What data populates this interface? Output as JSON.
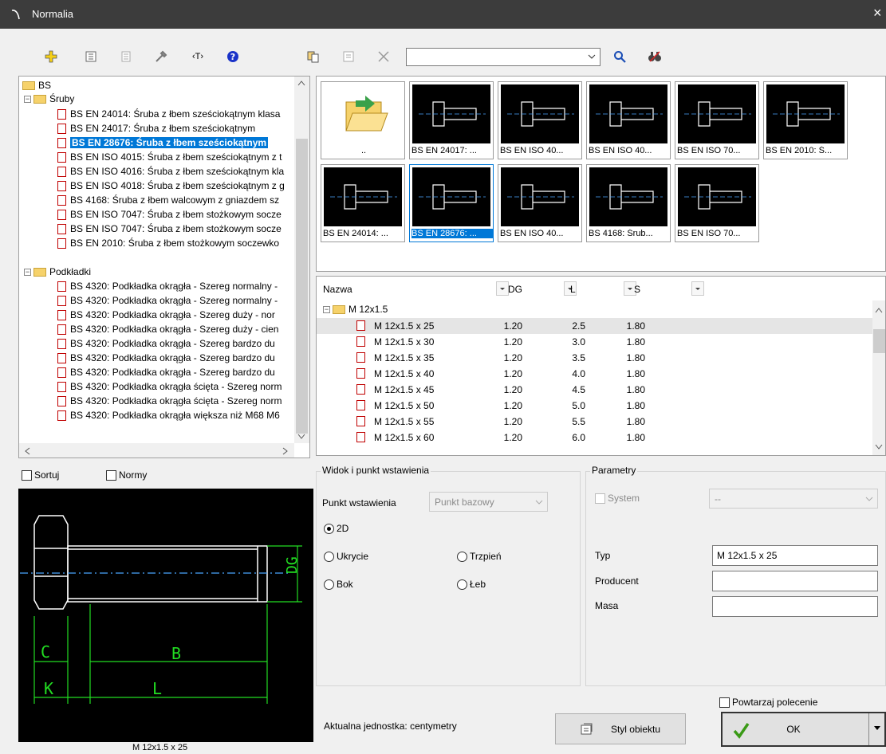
{
  "window": {
    "title": "Normalia",
    "close": "×"
  },
  "toolbar": {
    "search_value": "",
    "icons": [
      "add-icon",
      "properties-icon",
      "document-icon",
      "tools-icon",
      "text-icon",
      "help-icon",
      "copy-icon",
      "list-icon",
      "delete-icon",
      "search-icon",
      "binoculars-icon"
    ]
  },
  "tree": {
    "root": "BS",
    "folder1": "Śruby",
    "items1": [
      "BS EN 24014: Śruba z łbem sześciokątnym klasa",
      "BS EN 24017: Śruba z łbem sześciokątnym",
      "BS EN 28676: Śruba z łbem sześciokątnym",
      "BS EN ISO 4015: Śruba z łbem sześciokątnym z t",
      "BS EN ISO 4016: Śruba z łbem sześciokątnym kla",
      "BS EN ISO 4018: Śruba z łbem sześciokątnym z g",
      "BS 4168: Śruba z łbem walcowym z gniazdem sz",
      "BS EN ISO 7047: Śruba z łbem stożkowym socze",
      "BS EN ISO 7047: Śruba z łbem stożkowym socze",
      "BS EN 2010: Śruba z łbem stożkowym soczewko"
    ],
    "folder2": "Podkładki",
    "items2": [
      "BS 4320: Podkładka okrągła - Szereg normalny -",
      "BS 4320: Podkładka okrągła - Szereg normalny -",
      "BS 4320: Podkładka okrągła - Szereg duży - nor",
      "BS 4320: Podkładka okrągła - Szereg duży - cien",
      "BS 4320: Podkładka okrągła - Szereg bardzo du",
      "BS 4320: Podkładka okrągła - Szereg bardzo du",
      "BS 4320: Podkładka okrągła - Szereg bardzo du",
      "BS 4320: Podkładka okrągła ścięta - Szereg norm",
      "BS 4320: Podkładka okrągła ścięta - Szereg norm",
      "BS 4320: Podkładka okrągła większa niż M68 M6"
    ]
  },
  "thumbs": {
    "up": "..",
    "items": [
      "BS EN 24017: ...",
      "BS EN ISO 40...",
      "BS EN ISO 40...",
      "BS EN ISO 70...",
      "BS EN 2010: Ś...",
      "BS EN 24014: ...",
      "BS EN 28676: ...",
      "BS EN ISO 40...",
      "BS 4168: Śrub...",
      "BS EN ISO 70..."
    ]
  },
  "grid": {
    "headers": [
      "Nazwa",
      "DG",
      "L",
      "S"
    ],
    "group": "M 12x1.5",
    "rows": [
      [
        "M 12x1.5 x 25",
        "1.20",
        "2.5",
        "1.80"
      ],
      [
        "M 12x1.5 x 30",
        "1.20",
        "3.0",
        "1.80"
      ],
      [
        "M 12x1.5 x 35",
        "1.20",
        "3.5",
        "1.80"
      ],
      [
        "M 12x1.5 x 40",
        "1.20",
        "4.0",
        "1.80"
      ],
      [
        "M 12x1.5 x 45",
        "1.20",
        "4.5",
        "1.80"
      ],
      [
        "M 12x1.5 x 50",
        "1.20",
        "5.0",
        "1.80"
      ],
      [
        "M 12x1.5 x 55",
        "1.20",
        "5.5",
        "1.80"
      ],
      [
        "M 12x1.5 x 60",
        "1.20",
        "6.0",
        "1.80"
      ]
    ]
  },
  "options": {
    "sort": "Sortuj",
    "norms": "Normy"
  },
  "preview": {
    "caption": "M 12x1.5 x 25",
    "dims": {
      "dg": "DG",
      "c": "C",
      "b": "B",
      "k": "K",
      "l": "L"
    }
  },
  "view": {
    "group_title": "Widok i punkt wstawienia",
    "insert_label": "Punkt wstawienia",
    "insert_value": "Punkt bazowy",
    "r2d": "2D",
    "ukrycie": "Ukrycie",
    "trzpien": "Trzpień",
    "bok": "Bok",
    "leb": "Łeb"
  },
  "params": {
    "group_title": "Parametry",
    "system": "System",
    "system_value": "--",
    "typ_label": "Typ",
    "typ_value": "M 12x1.5 x 25",
    "producent_label": "Producent",
    "producent_value": "",
    "masa_label": "Masa",
    "masa_value": ""
  },
  "footer": {
    "unit": "Aktualna jednostka: centymetry",
    "style_btn": "Styl obiektu",
    "repeat": "Powtarzaj polecenie",
    "ok": "OK"
  }
}
